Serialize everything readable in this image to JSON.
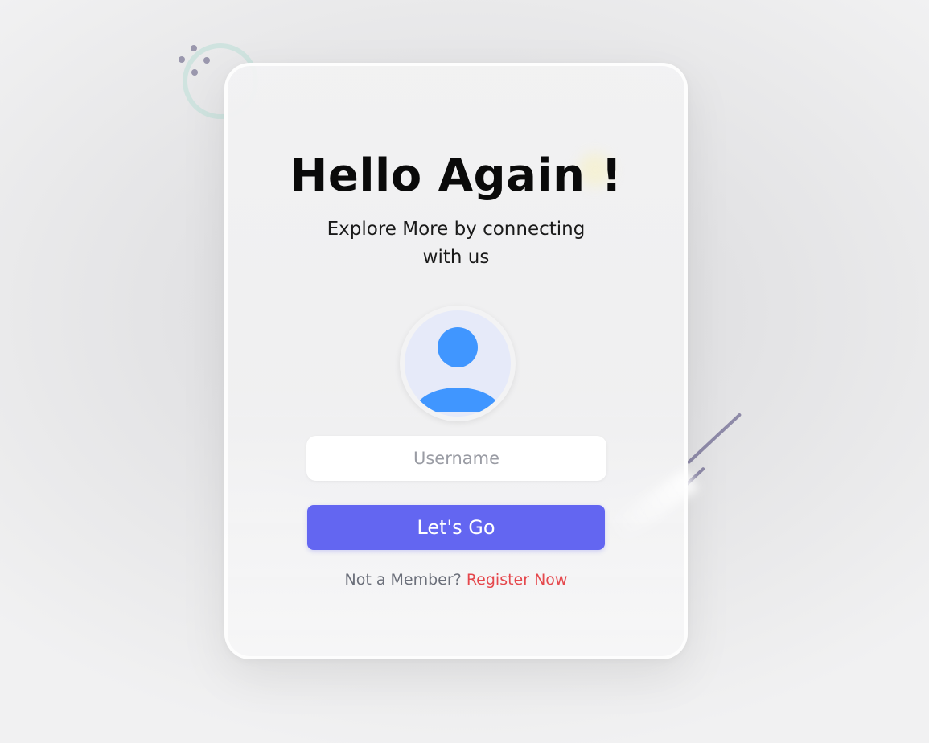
{
  "card": {
    "title": "Hello Again !",
    "subtitle": "Explore More by connecting with us"
  },
  "avatar": {
    "icon": "user-icon",
    "head_color": "#4096ff",
    "bg_color": "#e6eaf9"
  },
  "form": {
    "username_placeholder": "Username",
    "username_value": "",
    "submit_label": "Let's Go"
  },
  "register": {
    "prompt": "Not a Member?",
    "link_label": "Register Now"
  },
  "colors": {
    "accent": "#6366f1",
    "link": "#e5484d"
  }
}
